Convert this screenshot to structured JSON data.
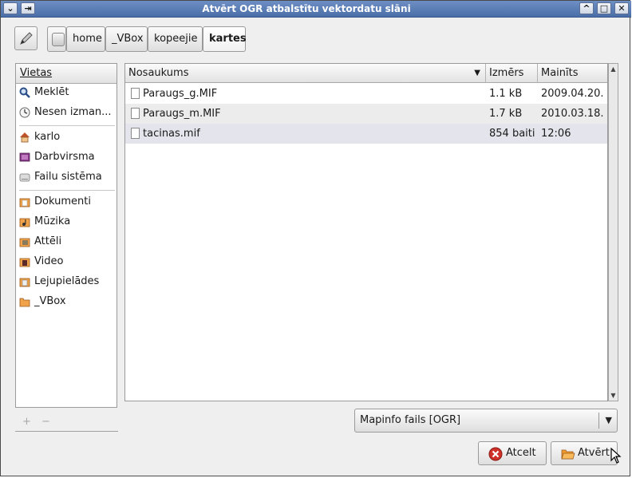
{
  "window": {
    "title": "Atvērt OGR atbalstītu vektordatu slāni",
    "controls": {
      "menu": "⌄",
      "pin": "⇥",
      "shade": "^",
      "maximize": "□",
      "close": "✕"
    }
  },
  "pathbar": {
    "edit_icon": "pencil-icon",
    "crumbs": [
      "home",
      "_VBox",
      "kopeejie",
      "kartes"
    ]
  },
  "places": {
    "header": "Vietas",
    "items": [
      {
        "label": "Meklēt",
        "icon": "search-icon"
      },
      {
        "label": "Nesen izman...",
        "icon": "recent-icon"
      },
      {
        "label": "karlo",
        "icon": "home-icon"
      },
      {
        "label": "Darbvirsma",
        "icon": "desktop-icon"
      },
      {
        "label": "Failu sistēma",
        "icon": "drive-icon"
      },
      {
        "label": "Dokumenti",
        "icon": "folder-icon"
      },
      {
        "label": "Mūzika",
        "icon": "folder-icon"
      },
      {
        "label": "Attēli",
        "icon": "folder-icon"
      },
      {
        "label": "Video",
        "icon": "folder-icon"
      },
      {
        "label": "Lejupielādes",
        "icon": "folder-icon"
      },
      {
        "label": "_VBox",
        "icon": "folder-icon"
      }
    ],
    "add_label": "+",
    "remove_label": "−"
  },
  "files": {
    "columns": [
      "Nosaukums",
      "Izmērs",
      "Mainīts"
    ],
    "rows": [
      {
        "name": "Paraugs_g.MIF",
        "size": "1.1 kB",
        "modified": "2009.04.20."
      },
      {
        "name": "Paraugs_m.MIF",
        "size": "1.7 kB",
        "modified": "2010.03.18."
      },
      {
        "name": "tacinas.mif",
        "size": "854 baiti",
        "modified": "12:06"
      }
    ]
  },
  "filter": {
    "selected": "Mapinfo fails [OGR]"
  },
  "buttons": {
    "cancel": "Atcelt",
    "open": "Atvērt"
  },
  "colors": {
    "titlebar": "#4a6ea8",
    "selected_row": "#e4e4ec",
    "cancel_icon": "#d0302a",
    "open_icon": "#f39a2e"
  }
}
